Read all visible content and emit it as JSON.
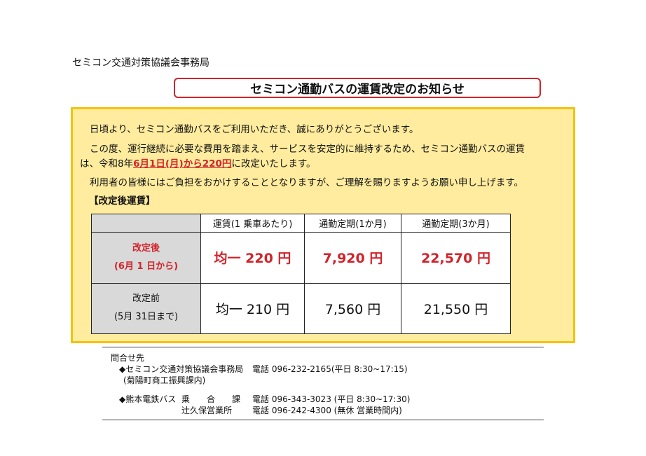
{
  "header": {
    "organization": "セミコン交通対策協議会事務局",
    "title": "セミコン通勤バスの運賃改定のお知らせ"
  },
  "notice": {
    "greeting": "日頃より、セミコン通勤バスをご利用いただき、誠にありがとうございます。",
    "line2": "この度、運行継続に必要な費用を踏まえ、サービスを安定的に維持するため、セミコン通勤バスの運賃",
    "line3_before": "は、令和8年",
    "line3_red": "6月1日(月)から220円",
    "line3_after": "に改定いたします。",
    "line4": "利用者の皆様にはご負担をおかけすることとなりますが、ご理解を賜りますようお願い申し上げます。",
    "fare_heading": "【改定後運賃】"
  },
  "fare_table": {
    "headers": [
      "運賃(1 乗車あたり)",
      "通勤定期(1か月)",
      "通勤定期(3か月)"
    ],
    "rows": [
      {
        "label": "改定後",
        "sublabel": "(6月 1 日から)",
        "values": [
          "均一 220 円",
          "7,920 円",
          "22,570 円"
        ]
      },
      {
        "label": "改定前",
        "sublabel": "(5月 31日まで)",
        "values": [
          "均一 210 円",
          "7,560 円",
          "21,550 円"
        ]
      }
    ]
  },
  "contact": {
    "heading": "問合せ先",
    "org1": "◆セミコン交通対策協議会事務局",
    "org1_phone": "電話 096-232-2165(平日 8:30~17:15)",
    "org1_note": "(菊陽町商工振興課内)",
    "org2": "◆熊本電鉄バス",
    "org2_dept1": "乗　　合　　課",
    "org2_phone1": "電話 096-343-3023 (平日 8:30~17:30)",
    "org2_dept2": "辻久保営業所",
    "org2_phone2": "電話 096-242-4300 (無休  営業時間内)"
  },
  "colors": {
    "accent_red": "#d2232a",
    "notice_bg": "#ffec9e",
    "notice_border": "#f4c20d",
    "table_label_bg": "#d9d9d9"
  }
}
